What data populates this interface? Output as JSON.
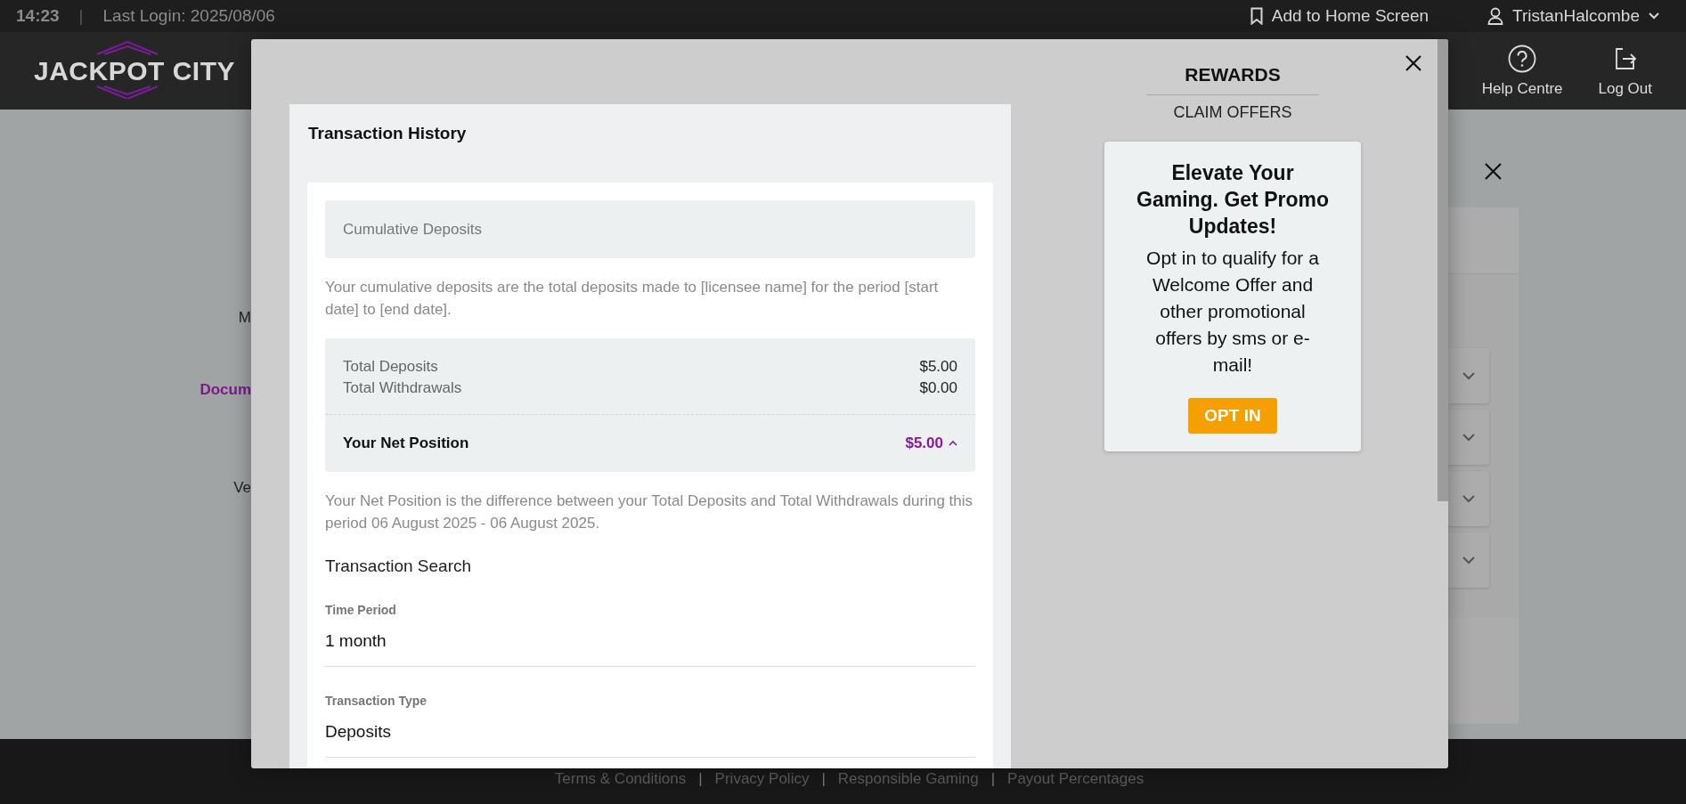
{
  "status_bar": {
    "left": [
      {
        "kind": "time",
        "text": "14:23"
      },
      {
        "kind": "separator",
        "text": "|"
      },
      {
        "kind": "login",
        "text": "Last Login: 2025/08/06"
      }
    ],
    "add_to_home": "Add to Home Screen",
    "username": "TristanHalcombe"
  },
  "header": {
    "logo": "JACKPOT CITY",
    "nav": [
      {
        "kind": "help",
        "label": "Help Centre"
      },
      {
        "kind": "logout",
        "label": "Log Out"
      }
    ]
  },
  "background_page": {
    "labels": [
      {
        "kind": "plain",
        "text": "M"
      },
      {
        "kind": "link",
        "text": "Docum"
      },
      {
        "kind": "plain",
        "text": "Ve"
      }
    ]
  },
  "modal": {
    "transaction_history": {
      "title": "Transaction History",
      "cumulative_heading": "Cumulative Deposits",
      "cumulative_note": "Your cumulative deposits are the total deposits made to [licensee name] for the period [start date] to [end date].",
      "totals": [
        {
          "label": "Total Deposits",
          "value": "$5.00"
        },
        {
          "label": "Total Withdrawals",
          "value": "$0.00"
        }
      ],
      "net_position": {
        "label": "Your Net Position",
        "value": "$5.00",
        "expanded": true
      },
      "net_note": "Your Net Position is the difference between your Total Deposits and Total Withdrawals during this period 06 August 2025 - 06 August 2025.",
      "search_heading": "Transaction Search",
      "fields": [
        {
          "label": "Time Period",
          "value": "1 month"
        },
        {
          "label": "Transaction Type",
          "value": "Deposits"
        }
      ]
    },
    "rewards": {
      "title": "REWARDS",
      "subtitle": "CLAIM OFFERS",
      "promo_heading": "Elevate Your Gaming. Get Promo Updates!",
      "promo_text": "Opt in to qualify for a Welcome Offer and other promotional offers by sms or e-mail!",
      "button": "OPT IN"
    }
  },
  "footer": {
    "items": [
      {
        "kind": "link",
        "text": "Terms & Conditions"
      },
      {
        "kind": "separator",
        "text": "|"
      },
      {
        "kind": "link",
        "text": "Privacy Policy"
      },
      {
        "kind": "separator",
        "text": "|"
      },
      {
        "kind": "link",
        "text": "Responsible Gaming"
      },
      {
        "kind": "separator",
        "text": "|"
      },
      {
        "kind": "link",
        "text": "Payout Percentages"
      }
    ]
  }
}
